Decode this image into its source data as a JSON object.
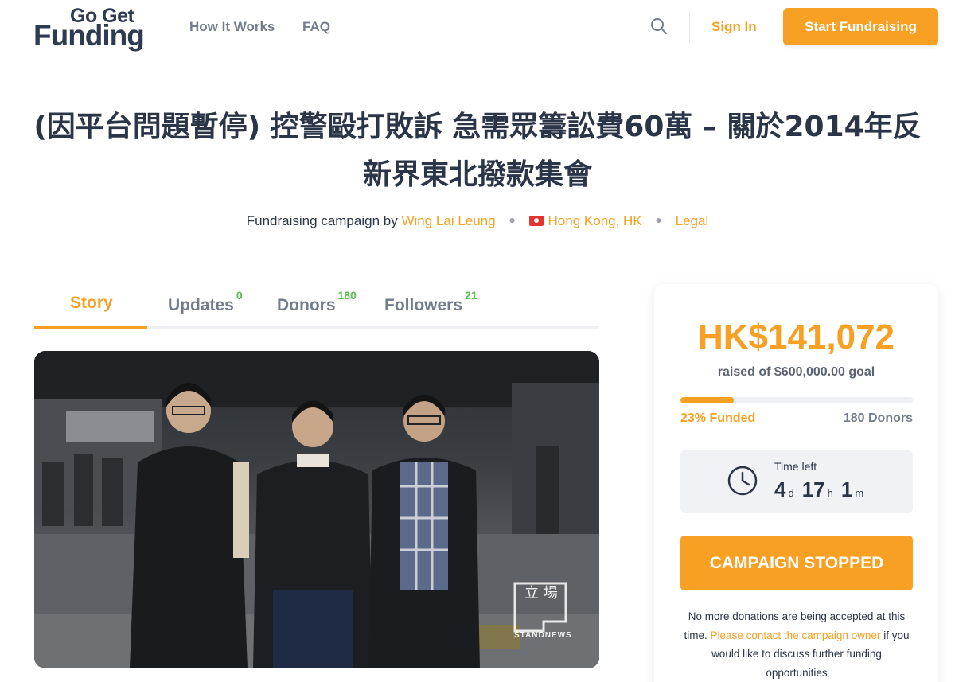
{
  "header": {
    "logo_line1": "Go Get",
    "logo_line2": "Funding",
    "nav": [
      "How It Works",
      "FAQ"
    ],
    "sign_in": "Sign In",
    "start_button": "Start Fundraising"
  },
  "campaign": {
    "title": "(因平台問題暫停) 控警毆打敗訴 急需眾籌訟費60萬 – 關於2014年反新界東北撥款集會",
    "byline_prefix": "Fundraising campaign by",
    "organizer": "Wing Lai Leung",
    "location": "Hong Kong, HK",
    "category": "Legal"
  },
  "tabs": [
    {
      "label": "Story",
      "count": ""
    },
    {
      "label": "Updates",
      "count": "0"
    },
    {
      "label": "Donors",
      "count": "180"
    },
    {
      "label": "Followers",
      "count": "21"
    }
  ],
  "photo": {
    "watermark_mark": "立 場",
    "watermark_text": "STANDNEWS"
  },
  "sidebar": {
    "amount": "HK$141,072",
    "goal": "raised of $600,000.00 goal",
    "progress_fraction": 0.23,
    "funded": "23% Funded",
    "donors": "180 Donors",
    "time_label": "Time left",
    "days": "4",
    "days_unit": "d",
    "hours": "17",
    "hours_unit": "h",
    "minutes": "1",
    "minutes_unit": "m",
    "stopped_button": "CAMPAIGN STOPPED",
    "note_before": "No more donations are being accepted at this time.",
    "note_link": "Please contact the campaign owner",
    "note_after": "if you would like to discuss further funding opportunities"
  },
  "colors": {
    "accent": "#f7a024",
    "text": "#2b3548",
    "muted": "#737c8c",
    "count_green": "#5bbd4f"
  }
}
